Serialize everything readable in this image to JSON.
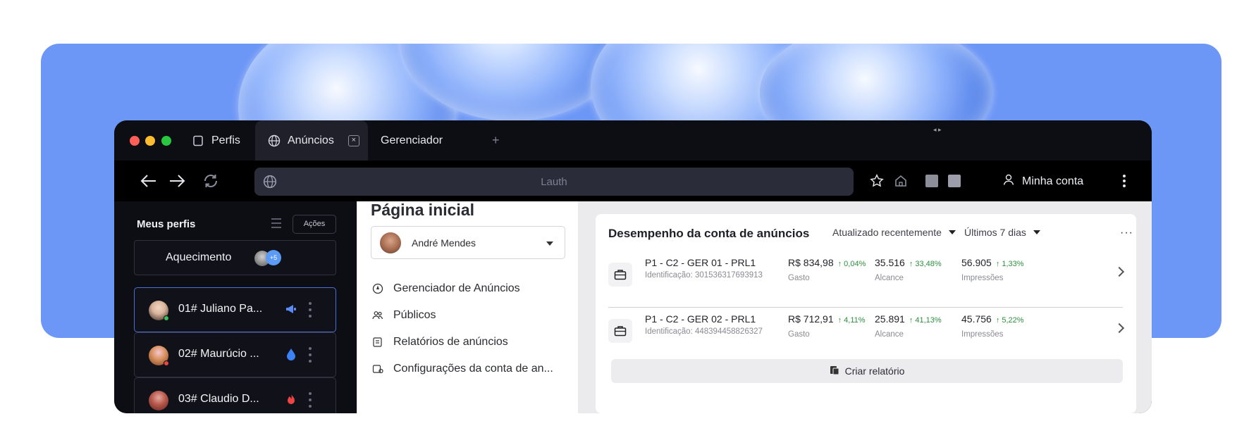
{
  "tabs": [
    {
      "label": "Perfis",
      "icon": "square-icon"
    },
    {
      "label": "Anúncios",
      "icon": "globe-icon"
    },
    {
      "label": "Gerenciador",
      "icon": ""
    }
  ],
  "new_tab_symbol": "+",
  "close_tab_symbol": "×",
  "resize_handle": "◂ ▸",
  "navbar": {
    "url_placeholder": "Lauth",
    "account_label": "Minha conta"
  },
  "sidebar": {
    "title": "Meus perfis",
    "actions_label": "Ações",
    "group": {
      "label": "Aquecimento",
      "extra_count": "+5"
    },
    "profiles": [
      {
        "name": "01# Juliano Pa...",
        "tag_icon": "megaphone-icon",
        "tag_color": "#5b8cf5",
        "avatar_colors": [
          "#e4c9b8",
          "#3a2a22"
        ],
        "status_color": "#3bbf5a"
      },
      {
        "name": "02# Maurúcio ...",
        "tag_icon": "drop-icon",
        "tag_color": "#3b82f6",
        "avatar_colors": [
          "#f2b6c1",
          "#8a4d2d"
        ],
        "status_color": "#e84545"
      },
      {
        "name": "03# Claudio D...",
        "tag_icon": "flame-icon",
        "tag_color": "#ef4444",
        "avatar_colors": [
          "#c9847b",
          "#6b2e2a"
        ],
        "status_color": "#e84545"
      }
    ]
  },
  "middle": {
    "title": "Página inicial",
    "user_name": "André Mendes",
    "links": [
      {
        "label": "Gerenciador de Anúncios",
        "icon": "compass-icon"
      },
      {
        "label": "Públicos",
        "icon": "people-icon"
      },
      {
        "label": "Relatórios de anúncios",
        "icon": "report-icon"
      },
      {
        "label": "Configurações da conta de an...",
        "icon": "settings-icon"
      }
    ]
  },
  "card": {
    "title": "Desempenho da conta de anúncios",
    "filter_updated": "Atualizado recentemente",
    "filter_period": "Últimos 7 dias",
    "more": "···",
    "rows": [
      {
        "account": "P1 - C2 - GER 01 - PRL1",
        "id": "Identificação: 301536317693913",
        "spend": "R$ 834,98",
        "spend_change": "↑ 0,04%",
        "spend_label": "Gasto",
        "reach": "35.516",
        "reach_change": "↑ 33,48%",
        "reach_label": "Alcance",
        "impr": "56.905",
        "impr_change": "↑ 1,33%",
        "impr_label": "Impressões"
      },
      {
        "account": "P1 - C2 - GER 02 - PRL1",
        "id": "Identificação: 448394458826327",
        "spend": "R$ 712,91",
        "spend_change": "↑ 4,11%",
        "spend_label": "Gasto",
        "reach": "25.891",
        "reach_change": "↑ 41,13%",
        "reach_label": "Alcance",
        "impr": "45.756",
        "impr_change": "↑ 5,22%",
        "impr_label": "Impressões"
      }
    ],
    "create_report": "Criar relatório"
  },
  "colors": {
    "panel_blue": "#6d97f6",
    "window_dark": "#0d0e14",
    "positive_green": "#2c8f3e",
    "selected_border": "#4c6fd6"
  }
}
